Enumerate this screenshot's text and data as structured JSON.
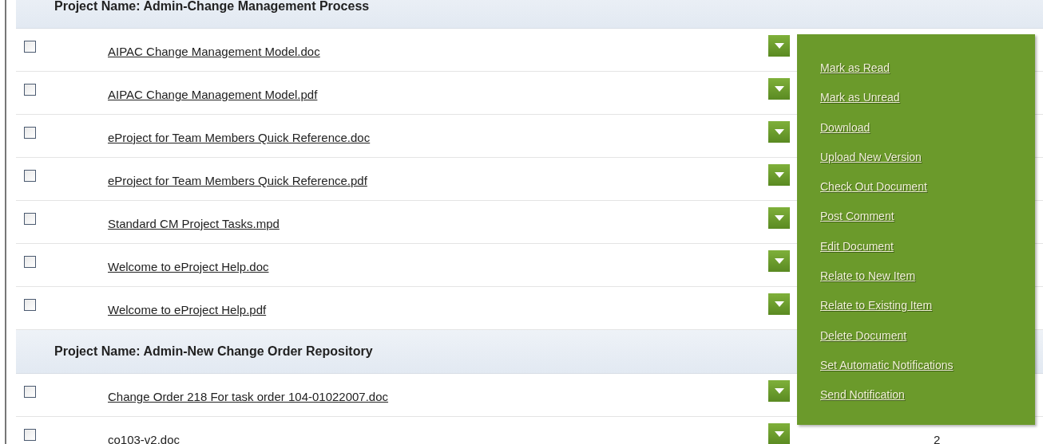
{
  "groups": [
    {
      "title": "Project Name: Admin-Change Management Process",
      "documents": [
        {
          "name": "AIPAC Change Management Model.doc",
          "checked": false
        },
        {
          "name": "AIPAC Change Management Model.pdf",
          "checked": false
        },
        {
          "name": "eProject for Team Members Quick Reference.doc",
          "checked": false
        },
        {
          "name": "eProject for Team Members Quick Reference.pdf",
          "checked": false
        },
        {
          "name": "Standard CM Project Tasks.mpd",
          "checked": false
        },
        {
          "name": "Welcome to eProject Help.doc",
          "checked": false
        },
        {
          "name": "Welcome to eProject Help.pdf",
          "checked": false
        }
      ]
    },
    {
      "title": "Project Name: Admin-New Change Order Repository",
      "documents": [
        {
          "name": "Change Order 218 For task order 104-01022007.doc",
          "checked": false
        },
        {
          "name": "co103-v2.doc",
          "checked": false,
          "count": "2"
        }
      ]
    }
  ],
  "menu": {
    "items": [
      "Mark as Read",
      "Mark as Unread",
      "Download",
      "Upload New Version",
      "Check Out Document",
      "Post Comment",
      "Edit Document",
      "Relate to New Item",
      "Relate to Existing Item",
      "Delete Document",
      "Set Automatic Notifications",
      "Send Notification"
    ]
  }
}
